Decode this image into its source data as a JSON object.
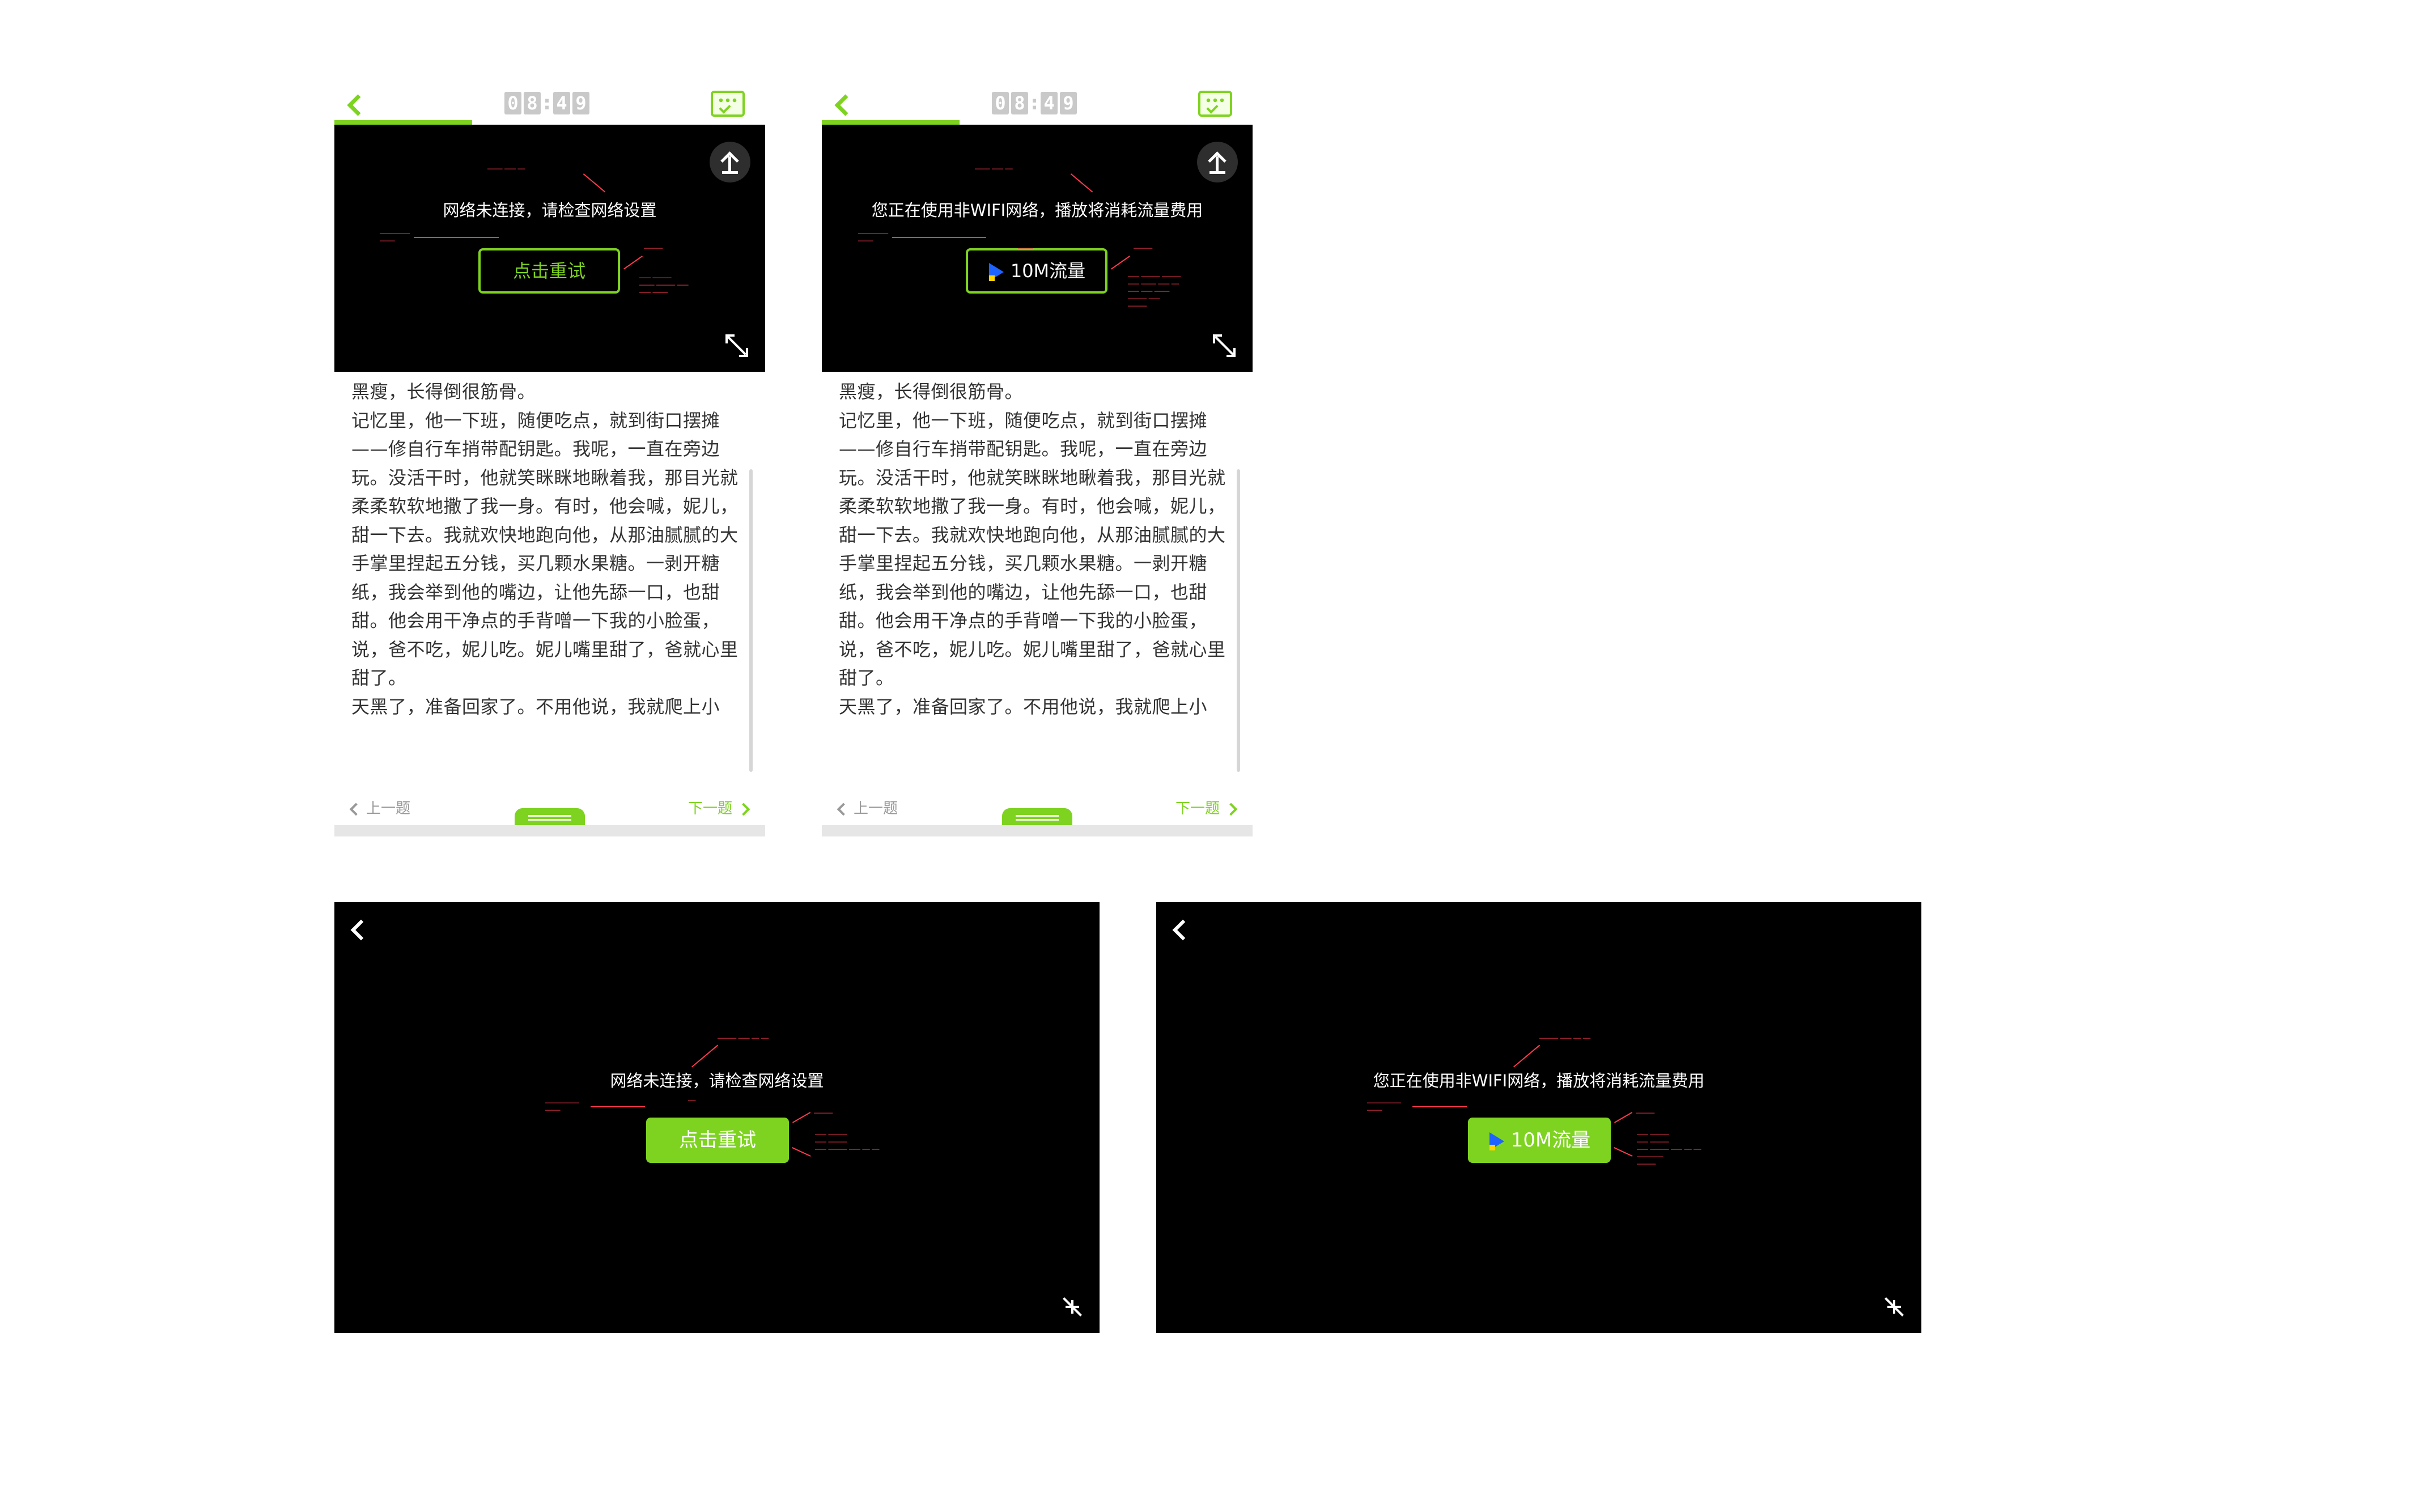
{
  "topbar": {
    "clock_digits": [
      "0",
      "8",
      "4",
      "9"
    ],
    "progress_fraction": 0.32,
    "back_icon": "back-chevron-icon",
    "answer_card_icon": "answer-card-icon"
  },
  "screens": {
    "offline": {
      "message": "网络未连接，请检查网络设置",
      "button_label": "点击重试"
    },
    "cellular": {
      "message": "您正在使用非WIFI网络，播放将消耗流量费用",
      "button_label": "10M流量"
    }
  },
  "article": {
    "paragraphs": [
      "黑瘦，长得倒很筋骨。",
      "记忆里，他一下班，随便吃点，就到街口摆摊——修自行车捎带配钥匙。我呢，一直在旁边玩。没活干时，他就笑眯眯地瞅着我，那目光就柔柔软软地撒了我一身。有时，他会喊，妮儿，甜一下去。我就欢快地跑向他，从那油腻腻的大手掌里捏起五分钱，买几颗水果糖。一剥开糖纸，我会举到他的嘴边，让他先舔一口，也甜甜。他会用干净点的手背噌一下我的小脸蛋，说，爸不吃，妮儿吃。妮儿嘴里甜了，爸就心里甜了。",
      "天黑了，准备回家了。不用他说，我就爬上小"
    ]
  },
  "footer": {
    "prev_label": "上一题",
    "next_label": "下一题"
  },
  "colors": {
    "accent": "#7ed321",
    "annotation": "#ff3b4e",
    "player_bg": "#000000"
  }
}
